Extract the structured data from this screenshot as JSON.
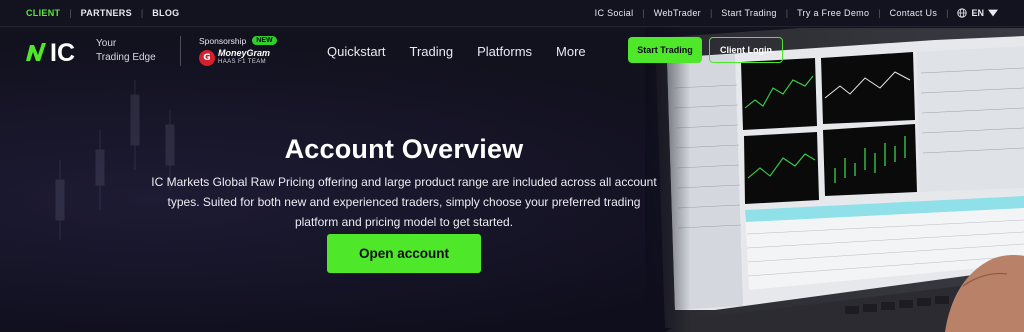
{
  "topbar": {
    "left_links": [
      "CLIENT",
      "PARTNERS",
      "BLOG"
    ],
    "right_links": [
      "IC Social",
      "WebTrader",
      "Start Trading",
      "Try a Free Demo",
      "Contact Us"
    ],
    "language": "EN"
  },
  "header": {
    "logo_text": "IC",
    "tagline_line1": "Your",
    "tagline_line2": "Trading Edge",
    "sponsorship_label": "Sponsorship",
    "sponsorship_badge": "NEW",
    "sponsor_name": "MoneyGram",
    "sponsor_team": "HAAS F1 TEAM",
    "sponsor_glyph": "G",
    "menu": [
      "Quickstart",
      "Trading",
      "Platforms",
      "More"
    ],
    "start_trading_label": "Start Trading",
    "client_login_label": "Client Login"
  },
  "hero": {
    "title": "Account Overview",
    "description": "IC Markets Global Raw Pricing offering and large product range are included across all account types. Suited for both new and experienced traders, simply choose your preferred trading platform and pricing model to get started.",
    "cta_label": "Open account"
  },
  "colors": {
    "accent_green": "#4ee72a",
    "background": "#0f0e1c",
    "active_link": "#5ce83a"
  },
  "icons": {
    "language": "globe-icon",
    "dropdown": "caret-down-icon"
  }
}
